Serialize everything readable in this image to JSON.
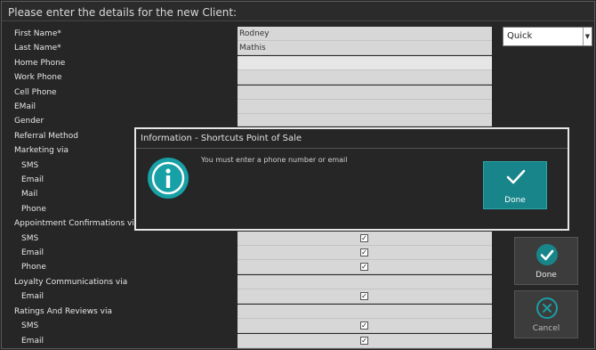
{
  "window": {
    "title": "Please enter the details for the new Client:"
  },
  "form": {
    "first_name": {
      "label": "First Name*",
      "value": "Rodney"
    },
    "last_name": {
      "label": "Last Name*",
      "value": "Mathis"
    },
    "home_phone": {
      "label": "Home Phone",
      "value": ""
    },
    "work_phone": {
      "label": "Work Phone",
      "value": ""
    },
    "cell_phone": {
      "label": "Cell Phone",
      "value": ""
    },
    "email": {
      "label": "EMail",
      "value": ""
    },
    "gender": {
      "label": "Gender"
    },
    "referral": {
      "label": "Referral Method"
    },
    "marketing": {
      "label": "Marketing via",
      "sms": "SMS",
      "email": "Email",
      "mail": "Mail",
      "phone": "Phone"
    },
    "appointment": {
      "label": "Appointment Confirmations via",
      "sms": "SMS",
      "email": "Email",
      "phone": "Phone",
      "checks": [
        true,
        true,
        true
      ]
    },
    "loyalty": {
      "label": "Loyalty Communications via",
      "email": "Email",
      "checks": [
        true
      ]
    },
    "ratings": {
      "label": "Ratings And Reviews via",
      "sms": "SMS",
      "email": "Email",
      "checks": [
        true,
        true
      ]
    },
    "check_mark": "✓"
  },
  "mode_select": {
    "value": "Quick"
  },
  "side_buttons": {
    "done": "Done",
    "cancel": "Cancel"
  },
  "dialog": {
    "title": "Information - Shortcuts Point of Sale",
    "message": "You must enter a phone number or email",
    "done": "Done"
  },
  "colors": {
    "accent": "#17858a",
    "background": "#262626",
    "field": "#d7d7d7"
  },
  "icons": [
    "info-icon",
    "checkmark-icon",
    "check-circle-icon",
    "cancel-circle-icon",
    "dropdown-arrow-icon"
  ]
}
